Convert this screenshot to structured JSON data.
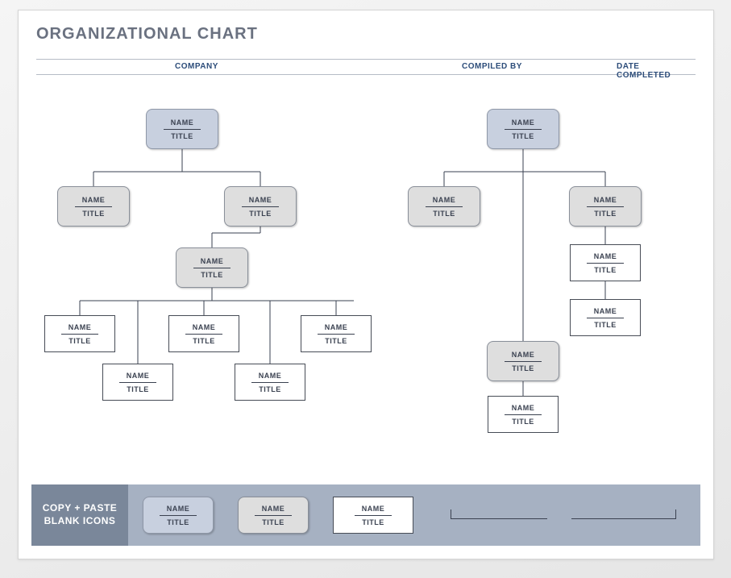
{
  "title": "ORGANIZATIONAL CHART",
  "header": {
    "company": "COMPANY",
    "compiled_by": "COMPILED BY",
    "date_completed": "DATE COMPLETED"
  },
  "placeholders": {
    "name": "NAME",
    "title": "TITLE"
  },
  "footer": {
    "label": "COPY + PASTE BLANK ICONS"
  },
  "chart_data": {
    "type": "tree",
    "trees": [
      {
        "id": "left",
        "root": {
          "style": "blue",
          "name": "NAME",
          "title": "TITLE",
          "children": [
            {
              "style": "gray",
              "name": "NAME",
              "title": "TITLE"
            },
            {
              "style": "gray",
              "name": "NAME",
              "title": "TITLE",
              "children": [
                {
                  "style": "gray",
                  "name": "NAME",
                  "title": "TITLE",
                  "children": [
                    {
                      "style": "white",
                      "name": "NAME",
                      "title": "TITLE"
                    },
                    {
                      "style": "white",
                      "name": "NAME",
                      "title": "TITLE"
                    },
                    {
                      "style": "white",
                      "name": "NAME",
                      "title": "TITLE"
                    },
                    {
                      "style": "white",
                      "name": "NAME",
                      "title": "TITLE"
                    },
                    {
                      "style": "white",
                      "name": "NAME",
                      "title": "TITLE"
                    }
                  ]
                }
              ]
            }
          ]
        }
      },
      {
        "id": "right",
        "root": {
          "style": "blue",
          "name": "NAME",
          "title": "TITLE",
          "children": [
            {
              "style": "gray",
              "name": "NAME",
              "title": "TITLE"
            },
            {
              "style": "gray",
              "name": "NAME",
              "title": "TITLE",
              "children": [
                {
                  "style": "white",
                  "name": "NAME",
                  "title": "TITLE"
                },
                {
                  "style": "white",
                  "name": "NAME",
                  "title": "TITLE"
                }
              ]
            },
            {
              "style": "gray",
              "name": "NAME",
              "title": "TITLE",
              "children": [
                {
                  "style": "white",
                  "name": "NAME",
                  "title": "TITLE"
                }
              ]
            }
          ]
        }
      }
    ],
    "palette": [
      {
        "style": "blue",
        "name": "NAME",
        "title": "TITLE"
      },
      {
        "style": "gray",
        "name": "NAME",
        "title": "TITLE"
      },
      {
        "style": "white",
        "name": "NAME",
        "title": "TITLE"
      }
    ]
  }
}
